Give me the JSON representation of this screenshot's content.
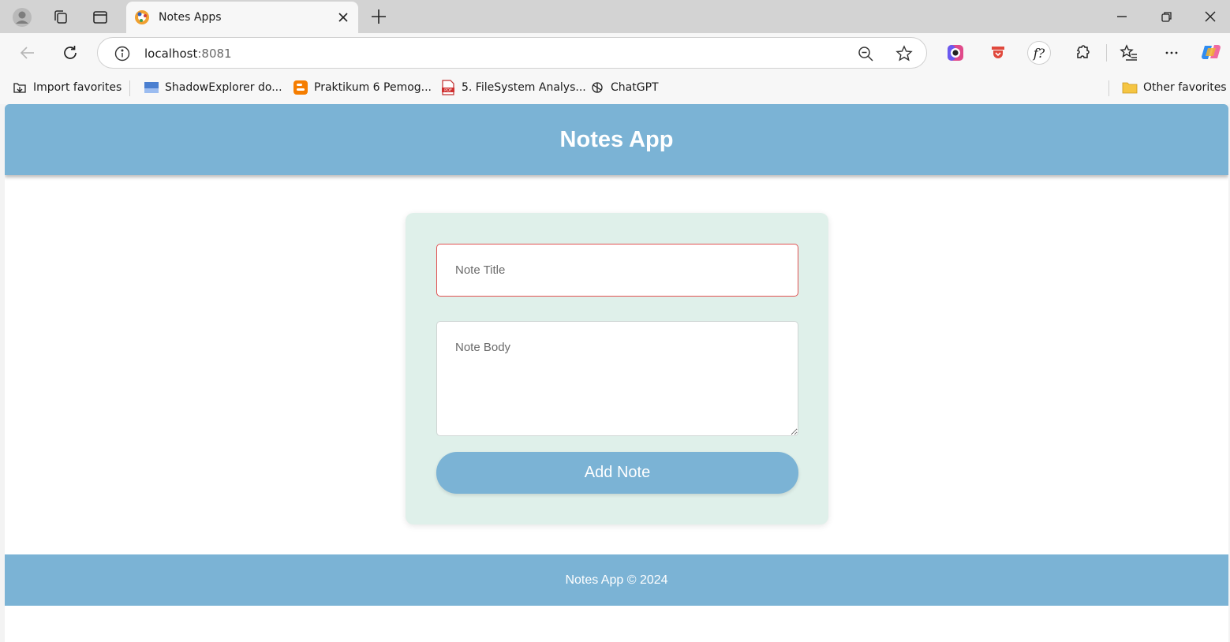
{
  "browser": {
    "tab": {
      "title": "Notes Apps"
    },
    "address": {
      "host": "localhost",
      "port": ":8081"
    },
    "favorites": [
      {
        "label": "Import favorites",
        "icon": "import-icon"
      },
      {
        "label": "ShadowExplorer do...",
        "icon": "shadowexplorer-icon"
      },
      {
        "label": "Praktikum 6 Pemog...",
        "icon": "blogger-icon"
      },
      {
        "label": "5. FileSystem Analys...",
        "icon": "pdf-icon"
      },
      {
        "label": "ChatGPT",
        "icon": "chatgpt-icon"
      }
    ],
    "other_favorites": "Other favorites",
    "extension_f_label": "f?"
  },
  "app": {
    "header_title": "Notes App",
    "form": {
      "title_placeholder": "Note Title",
      "body_placeholder": "Note Body",
      "add_button": "Add Note"
    },
    "footer_text": "Notes App © 2024"
  },
  "colors": {
    "accent": "#7bb3d5",
    "card_bg": "#dff0ea",
    "title_border": "#e05252"
  }
}
